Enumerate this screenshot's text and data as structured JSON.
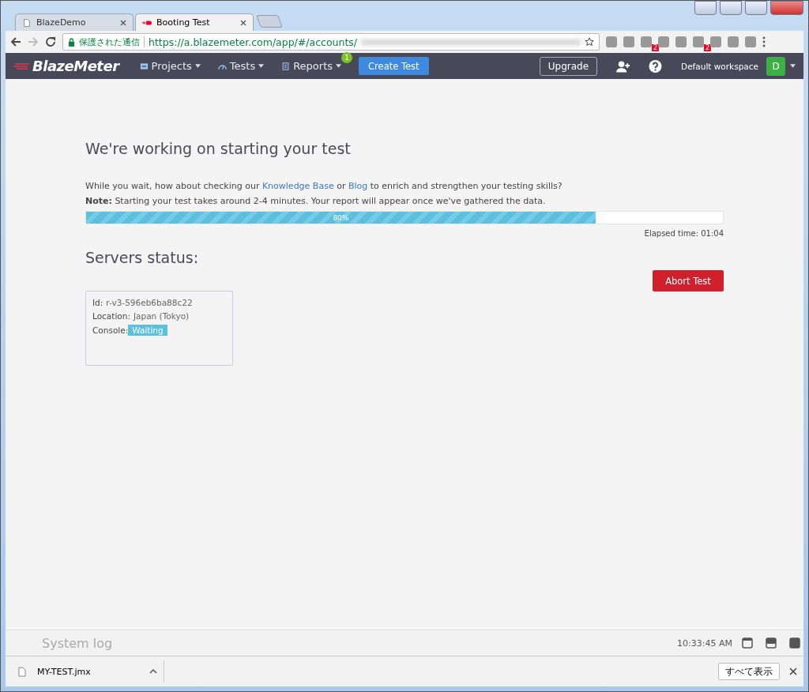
{
  "browser": {
    "tabs": [
      {
        "title": "BlazeDemo",
        "selected": false,
        "kind": "page"
      },
      {
        "title": "Booting Test",
        "selected": true,
        "kind": "blaze"
      }
    ],
    "secure_label": "保護された通信",
    "url": "https://a.blazemeter.com/app/#/accounts/",
    "extensions": [
      {
        "kind": "plain"
      },
      {
        "kind": "plain"
      },
      {
        "kind": "badged",
        "badge": "2"
      },
      {
        "kind": "plain"
      },
      {
        "kind": "plain"
      },
      {
        "kind": "badged",
        "badge": "2"
      },
      {
        "kind": "plain"
      },
      {
        "kind": "plain"
      },
      {
        "kind": "plain"
      }
    ]
  },
  "navbar": {
    "logo": "BlazeMeter",
    "menus": [
      {
        "label": "Projects"
      },
      {
        "label": "Tests"
      },
      {
        "label": "Reports",
        "badge": "1"
      }
    ],
    "create_button": "Create Test",
    "upgrade_button": "Upgrade",
    "workspace": "Default workspace",
    "avatar": "D"
  },
  "main": {
    "title": "We're working on starting your test",
    "intro": [
      "While you wait, how about checking our ",
      "Knowledge Base",
      " or ",
      "Blog",
      " to enrich and strengthen your testing skills?"
    ],
    "note": "**Note:** Starting your test takes around 2-4 minutes. Your report will appear once we've gathered the data.",
    "progress": {
      "level": 0.8,
      "label": "80%"
    },
    "elapsed": "Elapsed time: 01:04",
    "servers_title": "Servers status:",
    "abort_button": "Abort Test",
    "server": {
      "id_label": "Id:",
      "id": "r-v3-596eb6ba88c22",
      "location_label": "Location:",
      "location": "Japan (Tokyo)",
      "console_label": "Console:",
      "status": "Waiting"
    }
  },
  "system_log": {
    "title": "System log",
    "time": "10:33:45 AM"
  },
  "downloads": {
    "file": "MY-TEST.jmx",
    "show_all": "すべて表示"
  }
}
